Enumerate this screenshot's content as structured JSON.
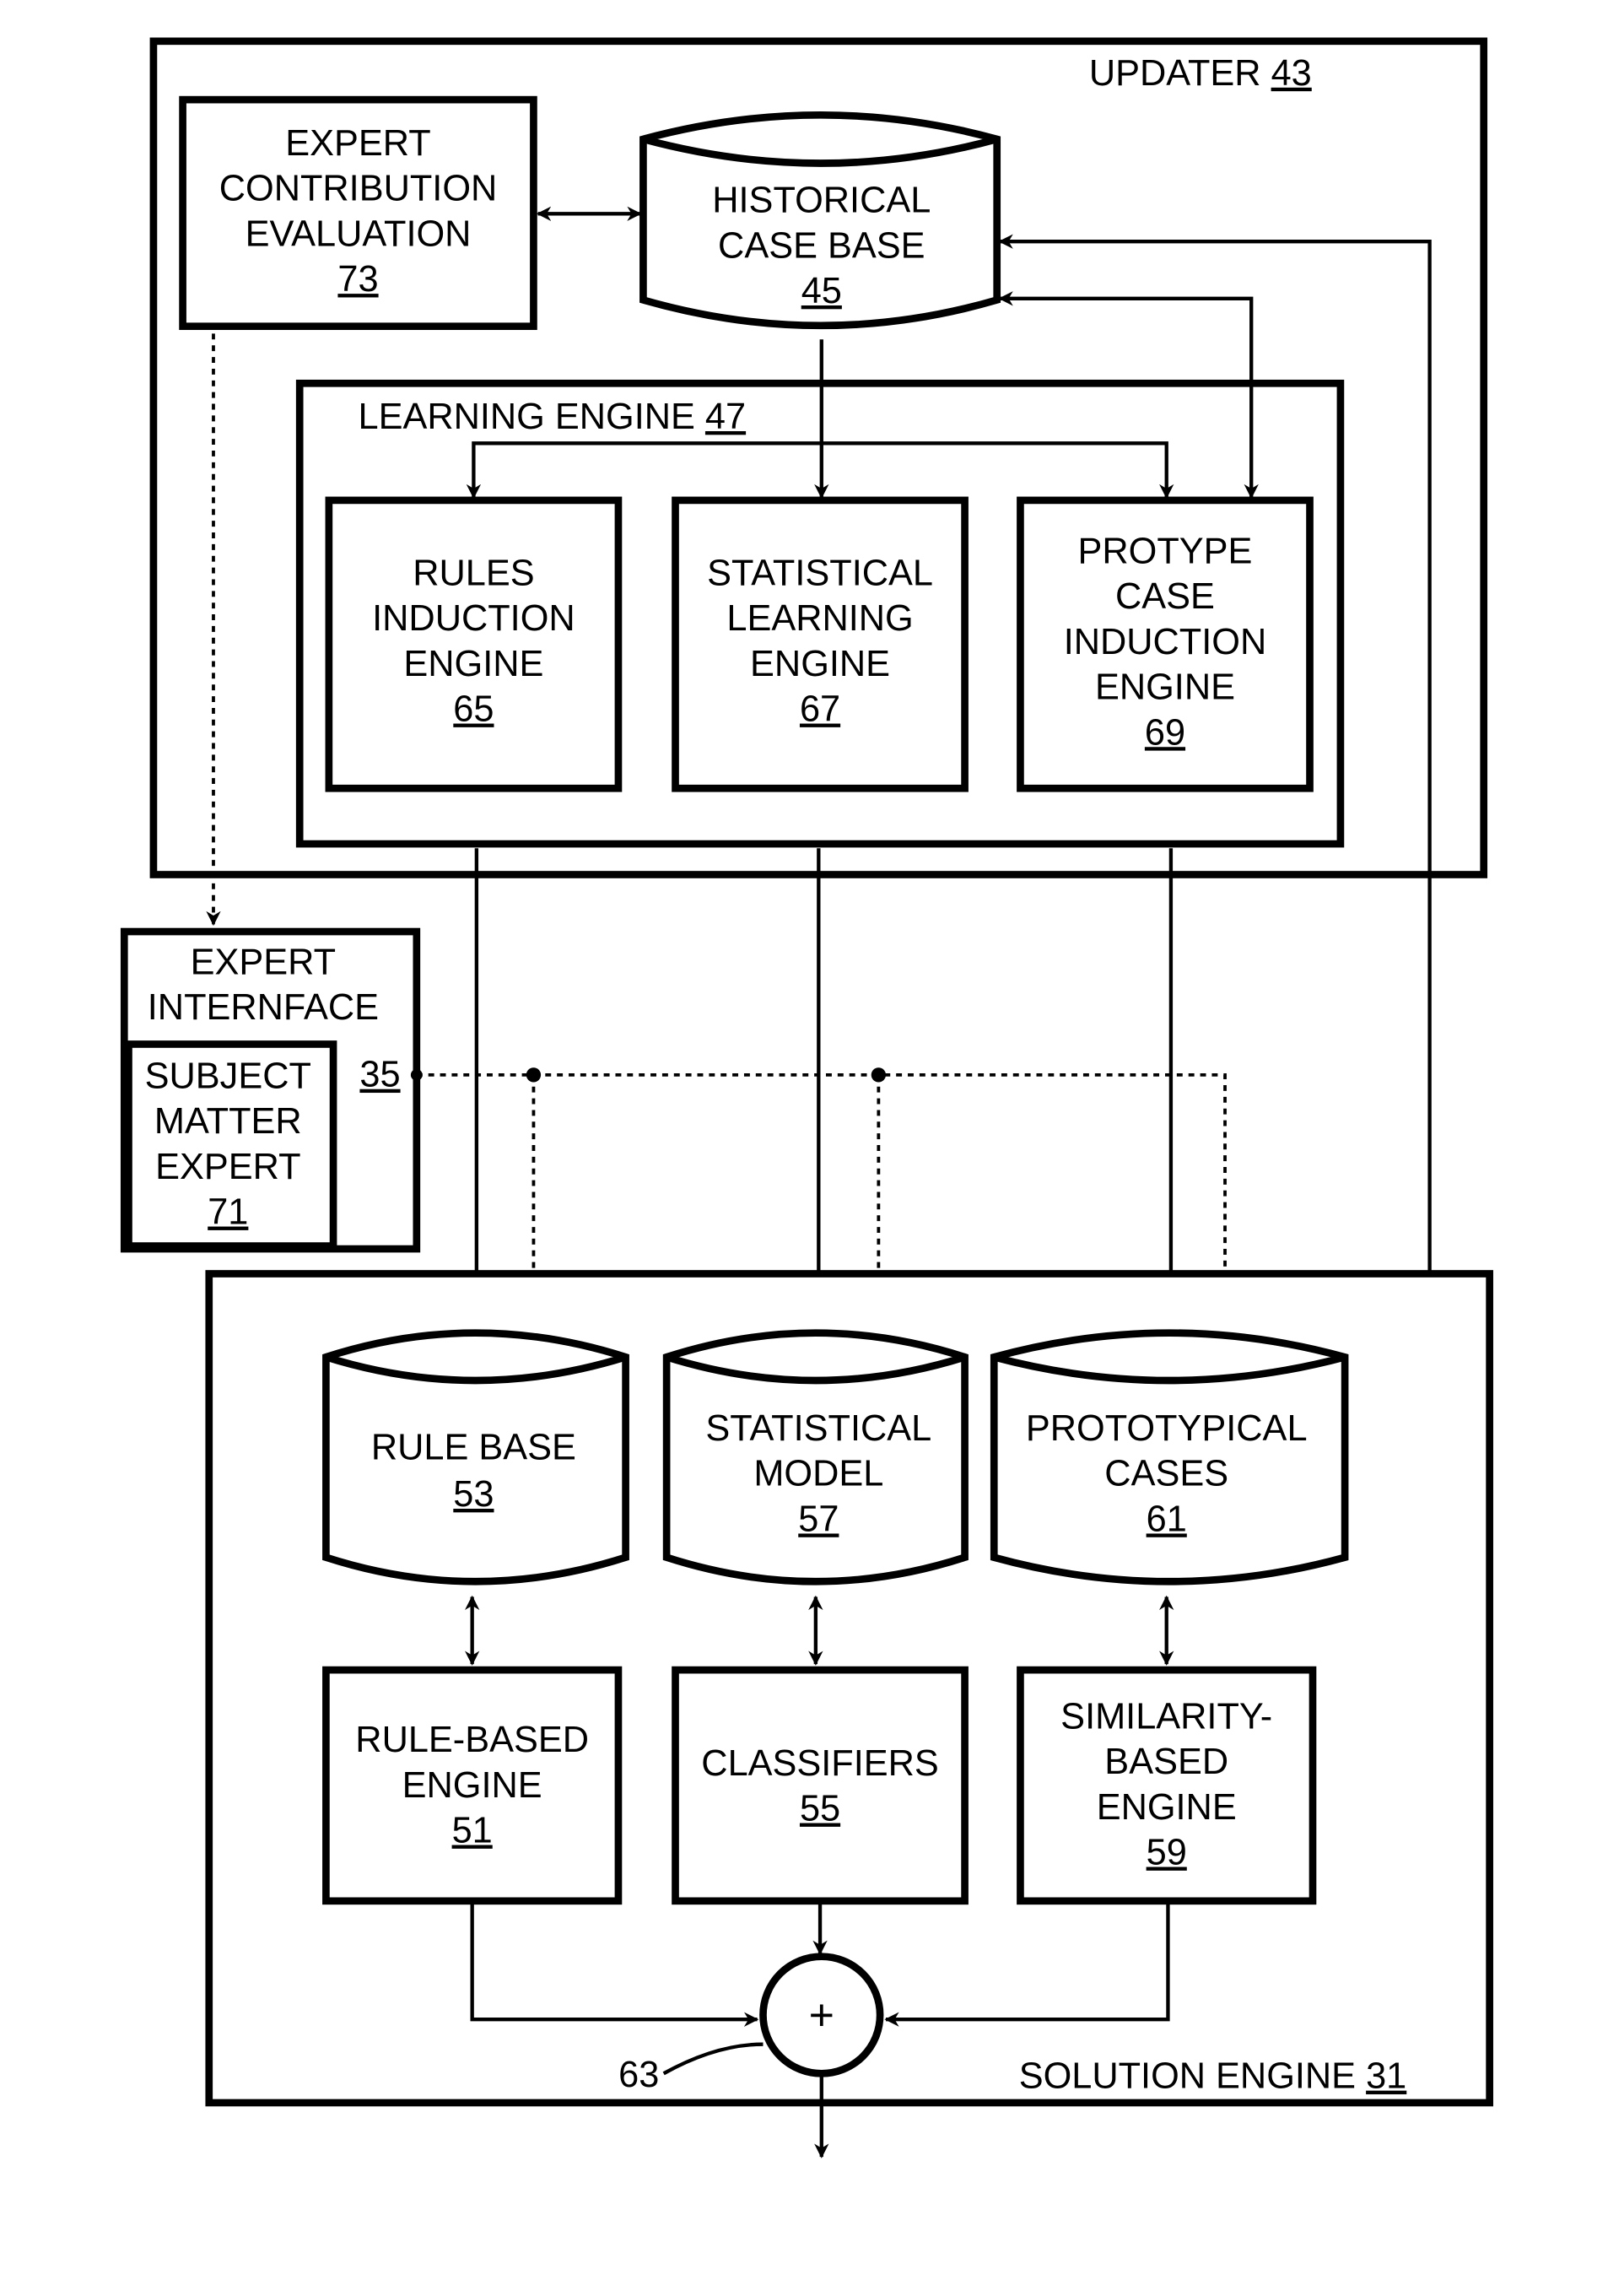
{
  "updater": {
    "label": "UPDATER",
    "ref": "43"
  },
  "expert_contribution": {
    "lines": [
      "EXPERT",
      "CONTRIBUTION",
      "EVALUATION"
    ],
    "ref": "73"
  },
  "historical_case_base": {
    "lines": [
      "HISTORICAL",
      "CASE BASE"
    ],
    "ref": "45"
  },
  "learning_engine": {
    "label": "LEARNING ENGINE",
    "ref": "47"
  },
  "rules_induction": {
    "lines": [
      "RULES",
      "INDUCTION",
      "ENGINE"
    ],
    "ref": "65"
  },
  "statistical_learning": {
    "lines": [
      "STATISTICAL",
      "LEARNING",
      "ENGINE"
    ],
    "ref": "67"
  },
  "prototype_induction": {
    "lines": [
      "PROTYPE",
      "CASE",
      "INDUCTION",
      "ENGINE"
    ],
    "ref": "69"
  },
  "expert_interface": {
    "lines": [
      "EXPERT",
      "INTERNFACE"
    ],
    "ref": "35"
  },
  "subject_matter_expert": {
    "lines": [
      "SUBJECT",
      "MATTER",
      "EXPERT"
    ],
    "ref": "71"
  },
  "rule_base": {
    "lines": [
      "RULE BASE"
    ],
    "ref": "53"
  },
  "statistical_model": {
    "lines": [
      "STATISTICAL",
      "MODEL"
    ],
    "ref": "57"
  },
  "prototypical_cases": {
    "lines": [
      "PROTOTYPICAL",
      "CASES"
    ],
    "ref": "61"
  },
  "rule_based_engine": {
    "lines": [
      "RULE-BASED",
      "ENGINE"
    ],
    "ref": "51"
  },
  "classifiers": {
    "lines": [
      "CLASSIFIERS"
    ],
    "ref": "55"
  },
  "similarity_engine": {
    "lines": [
      "SIMILARITY-",
      "BASED",
      "ENGINE"
    ],
    "ref": "59"
  },
  "combiner": {
    "symbol": "+",
    "ref": "63"
  },
  "solution_engine": {
    "label": "SOLUTION ENGINE",
    "ref": "31"
  }
}
